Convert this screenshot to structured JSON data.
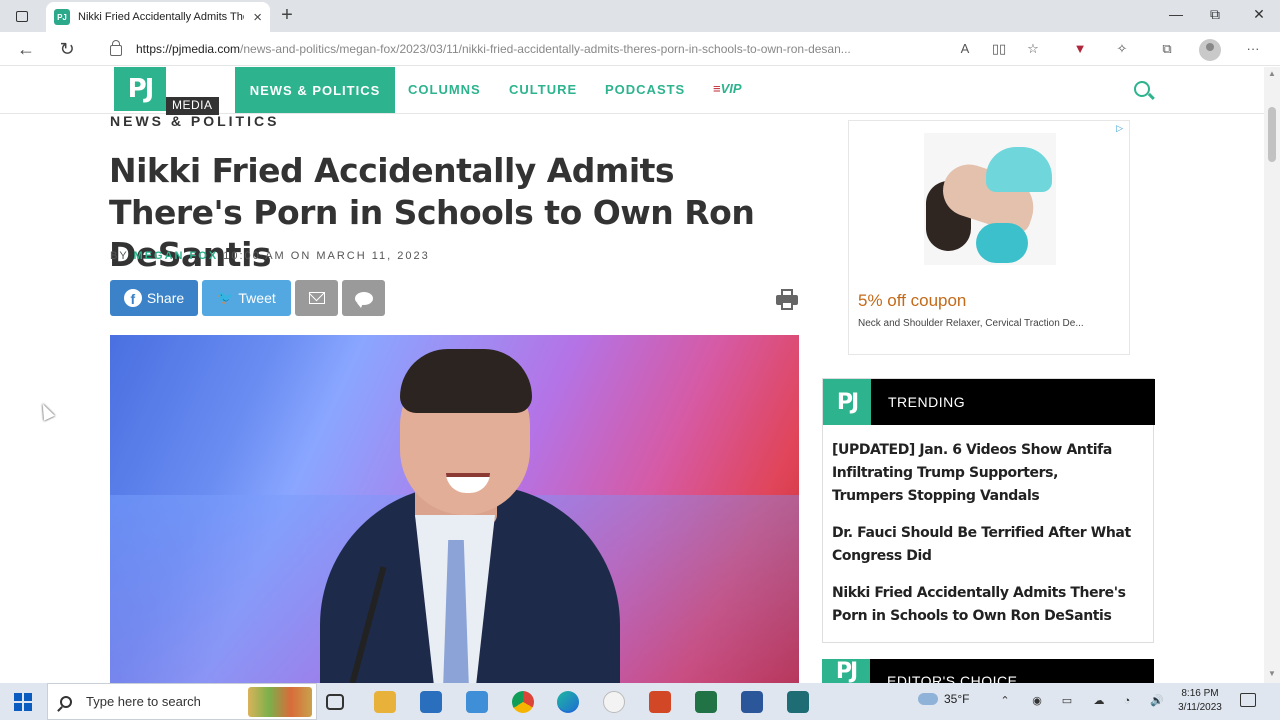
{
  "browser": {
    "tab_title": "Nikki Fried Accidentally Admits There's Porn in Schools to Own Ron DeSantis",
    "tab_favicon": "PJ",
    "new_tab": "+",
    "minimize": "—",
    "restore": "⧉",
    "close": "✕",
    "back": "←",
    "reload": "↻",
    "url_domain": "https://pjmedia.com",
    "url_path": "/news-and-politics/megan-fox/2023/03/11/nikki-fried-accidentally-admits-theres-porn-in-schools-to-own-ron-desan...",
    "read_aloud": "A",
    "more": "···"
  },
  "site": {
    "logo": "PJ",
    "logo_sub": "MEDIA",
    "nav": [
      "NEWS & POLITICS",
      "COLUMNS",
      "CULTURE",
      "PODCASTS"
    ],
    "nav_vip_flag": "≡",
    "nav_vip": "VIP",
    "accent": "#2db38e"
  },
  "article": {
    "kicker": "NEWS & POLITICS",
    "headline": "Nikki Fried Accidentally Admits There's Porn in Schools to Own Ron DeSantis",
    "by": "BY",
    "author": "MEGAN FOX",
    "time": "10:00 AM ON MARCH 11, 2023",
    "share_fb": "Share",
    "share_tw": "Tweet",
    "fb_glyph": "f",
    "tw_glyph": "🐦"
  },
  "ad": {
    "choice": "▷",
    "coupon": "5% off coupon",
    "description": "Neck and Shoulder Relaxer, Cervical Traction De..."
  },
  "trending": {
    "logo": "PJ",
    "title": "TRENDING",
    "items": [
      "[UPDATED] Jan. 6 Videos Show Antifa Infiltrating Trump Supporters, Trumpers Stopping Vandals",
      "Dr. Fauci Should Be Terrified After What Congress Did",
      "Nikki Fried Accidentally Admits There's Porn in Schools to Own Ron DeSantis"
    ]
  },
  "editors": {
    "logo": "PJ",
    "title": "EDITOR'S CHOICE"
  },
  "taskbar": {
    "search_placeholder": "Type here to search",
    "weather": "35°F",
    "time": "8:16 PM",
    "date": "3/11/2023"
  }
}
